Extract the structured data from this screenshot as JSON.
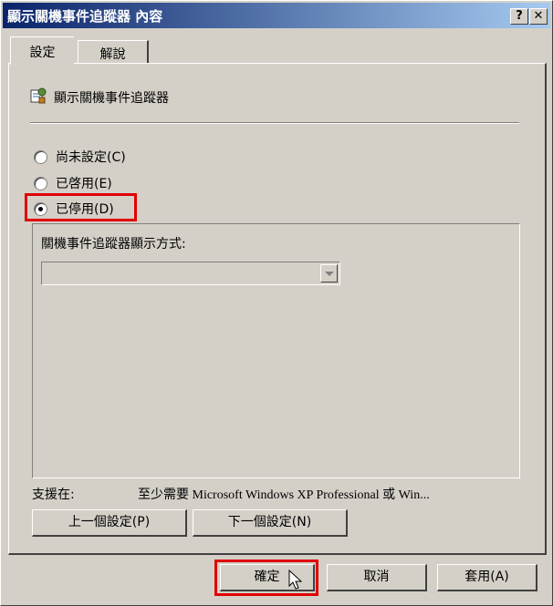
{
  "window": {
    "title": "顯示關機事件追蹤器 內容",
    "help_btn": "?",
    "close_btn": "✕"
  },
  "tabs": [
    {
      "label": "設定"
    },
    {
      "label": "解說"
    }
  ],
  "policy": {
    "name": "顯示關機事件追蹤器",
    "icon": "policy-icon"
  },
  "options": {
    "not_configured": "尚未設定(C)",
    "enabled": "已啓用(E)",
    "disabled": "已停用(D)",
    "selected": "disabled"
  },
  "group": {
    "label": "關機事件追蹤器顯示方式:",
    "combo_value": ""
  },
  "supported": {
    "label": "支援在:",
    "value": "至少需要 Microsoft Windows XP Professional 或 Win..."
  },
  "nav": {
    "prev": "上一個設定(P)",
    "next": "下一個設定(N)"
  },
  "buttons": {
    "ok": "確定",
    "cancel": "取消",
    "apply": "套用(A)"
  },
  "colors": {
    "highlight": "#e00000",
    "titlebar": "#0a246a"
  }
}
